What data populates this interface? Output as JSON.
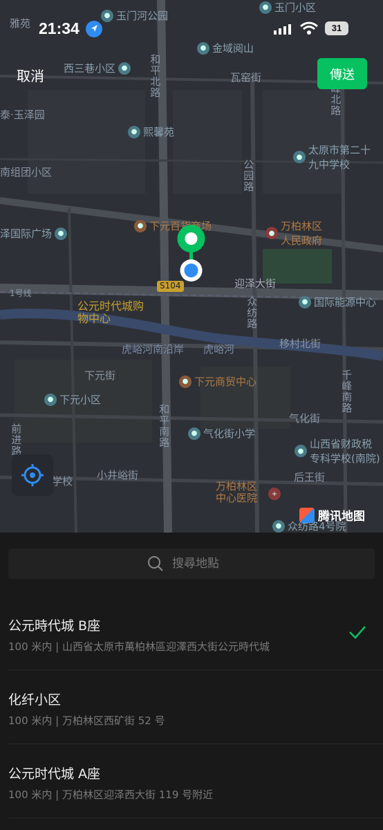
{
  "status_bar": {
    "time": "21:34",
    "battery": "31"
  },
  "header": {
    "cancel_label": "取消",
    "send_label": "傳送"
  },
  "map": {
    "labels": {
      "yumen_community": "玉门小区",
      "yumenhe_park": "玉门河公园",
      "yayuan": "雅苑",
      "jinchengge": "金域阅山",
      "xisanxiang": "西三巷小区",
      "heping_north": "和平北路",
      "waiyao": "瓦窑街",
      "feng_north": "峰北路",
      "yuzeyuan": "泰·玉泽园",
      "xixinyuan": "熙馨苑",
      "school29": "太原市第二十九中学校",
      "nanzutuan": "南组团小区",
      "gongyuan_road": "公园路",
      "yize_plaza": "泽国际广场",
      "xiayuan_mall": "下元百货商场",
      "wanbailin_gov": "万柏林区人民政府",
      "road_1": "1号线",
      "s104": "S104",
      "yingze_street": "迎泽大街",
      "zhongfang_road": "众纺路",
      "energy_center": "国际能源中心",
      "gongyuan_mall": "公元时代城购物中心",
      "huyu_south": "虎峪河南沿岸",
      "huyu_river": "虎峪河",
      "yicun_north": "移村北街",
      "xiayuan_street": "下元街",
      "xiayuan_trade": "下元商贸中心",
      "qianfeng_south": "千峰南路",
      "xiayuan_community": "下元小区",
      "heping_south": "和平南路",
      "qianjin_road": "前进路",
      "qihua_school": "气化街小学",
      "qihua_street": "气化街",
      "finance_school": "山西省财政税专科学校(南院)",
      "xiaojingyu": "小井峪街",
      "houwang": "后王街",
      "wanbailin_hospital": "万柏林区中心医院",
      "xiaoxue": "十学校",
      "zhongfang4": "众纺路4号院",
      "brand": "腾讯地图"
    }
  },
  "search": {
    "placeholder": "搜尋地點"
  },
  "results": [
    {
      "name": "公元時代城 B座",
      "address": "100 米内 | 山西省太原市萬柏林區迎澤西大街公元時代城",
      "selected": true
    },
    {
      "name": "化纤小区",
      "address": "100 米内 | 万柏林区西矿街 52 号",
      "selected": false
    },
    {
      "name": "公元时代城 A座",
      "address": "100 米内 | 万柏林区迎泽西大街 119 号附近",
      "selected": false
    }
  ],
  "colors": {
    "accent": "#07c160",
    "map_bg": "#2d3036"
  }
}
